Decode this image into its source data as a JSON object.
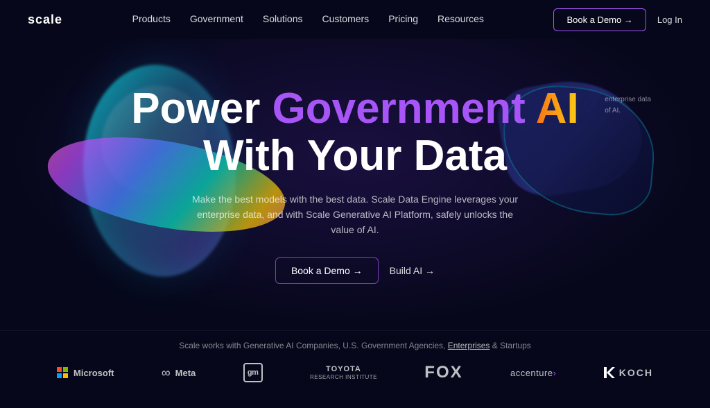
{
  "nav": {
    "logo": "scale",
    "links": [
      {
        "id": "products",
        "label": "Products"
      },
      {
        "id": "government",
        "label": "Government"
      },
      {
        "id": "solutions",
        "label": "Solutions"
      },
      {
        "id": "customers",
        "label": "Customers"
      },
      {
        "id": "pricing",
        "label": "Pricing"
      },
      {
        "id": "resources",
        "label": "Resources"
      }
    ],
    "book_demo": "Book a Demo →",
    "login": "Log In"
  },
  "hero": {
    "title_line1_part1": "Power ",
    "title_line1_part2": "Government ",
    "title_line1_part3": "AI",
    "title_line2": "With Your Data",
    "subtitle": "Make the best models with the best data. Scale Data Engine leverages your enterprise data, and with Scale Generative AI Platform, safely unlocks the value of AI.",
    "btn_demo": "Book a Demo →",
    "btn_build": "Build AI →"
  },
  "logos": {
    "tagline_prefix": "Scale works with Generative AI Companies, U.S. Government Agencies, ",
    "tagline_link": "Enterprises",
    "tagline_suffix": " & Startups",
    "companies": [
      {
        "id": "microsoft",
        "name": "Microsoft"
      },
      {
        "id": "meta",
        "name": "Meta"
      },
      {
        "id": "gm",
        "name": "gm"
      },
      {
        "id": "toyota",
        "name": "TOYOTA RESEARCH INSTITUTE"
      },
      {
        "id": "fox",
        "name": "FOX"
      },
      {
        "id": "accenture",
        "name": "accenture"
      },
      {
        "id": "koch",
        "name": "KKOCH"
      }
    ]
  }
}
